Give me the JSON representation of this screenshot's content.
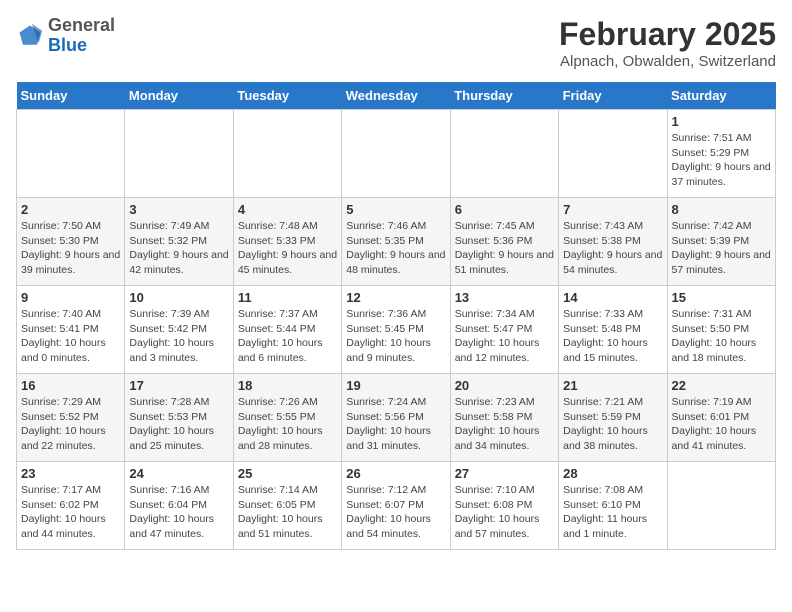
{
  "header": {
    "logo_general": "General",
    "logo_blue": "Blue",
    "month_title": "February 2025",
    "location": "Alpnach, Obwalden, Switzerland"
  },
  "days_of_week": [
    "Sunday",
    "Monday",
    "Tuesday",
    "Wednesday",
    "Thursday",
    "Friday",
    "Saturday"
  ],
  "weeks": [
    [
      {
        "day": "",
        "info": ""
      },
      {
        "day": "",
        "info": ""
      },
      {
        "day": "",
        "info": ""
      },
      {
        "day": "",
        "info": ""
      },
      {
        "day": "",
        "info": ""
      },
      {
        "day": "",
        "info": ""
      },
      {
        "day": "1",
        "info": "Sunrise: 7:51 AM\nSunset: 5:29 PM\nDaylight: 9 hours and 37 minutes."
      }
    ],
    [
      {
        "day": "2",
        "info": "Sunrise: 7:50 AM\nSunset: 5:30 PM\nDaylight: 9 hours and 39 minutes."
      },
      {
        "day": "3",
        "info": "Sunrise: 7:49 AM\nSunset: 5:32 PM\nDaylight: 9 hours and 42 minutes."
      },
      {
        "day": "4",
        "info": "Sunrise: 7:48 AM\nSunset: 5:33 PM\nDaylight: 9 hours and 45 minutes."
      },
      {
        "day": "5",
        "info": "Sunrise: 7:46 AM\nSunset: 5:35 PM\nDaylight: 9 hours and 48 minutes."
      },
      {
        "day": "6",
        "info": "Sunrise: 7:45 AM\nSunset: 5:36 PM\nDaylight: 9 hours and 51 minutes."
      },
      {
        "day": "7",
        "info": "Sunrise: 7:43 AM\nSunset: 5:38 PM\nDaylight: 9 hours and 54 minutes."
      },
      {
        "day": "8",
        "info": "Sunrise: 7:42 AM\nSunset: 5:39 PM\nDaylight: 9 hours and 57 minutes."
      }
    ],
    [
      {
        "day": "9",
        "info": "Sunrise: 7:40 AM\nSunset: 5:41 PM\nDaylight: 10 hours and 0 minutes."
      },
      {
        "day": "10",
        "info": "Sunrise: 7:39 AM\nSunset: 5:42 PM\nDaylight: 10 hours and 3 minutes."
      },
      {
        "day": "11",
        "info": "Sunrise: 7:37 AM\nSunset: 5:44 PM\nDaylight: 10 hours and 6 minutes."
      },
      {
        "day": "12",
        "info": "Sunrise: 7:36 AM\nSunset: 5:45 PM\nDaylight: 10 hours and 9 minutes."
      },
      {
        "day": "13",
        "info": "Sunrise: 7:34 AM\nSunset: 5:47 PM\nDaylight: 10 hours and 12 minutes."
      },
      {
        "day": "14",
        "info": "Sunrise: 7:33 AM\nSunset: 5:48 PM\nDaylight: 10 hours and 15 minutes."
      },
      {
        "day": "15",
        "info": "Sunrise: 7:31 AM\nSunset: 5:50 PM\nDaylight: 10 hours and 18 minutes."
      }
    ],
    [
      {
        "day": "16",
        "info": "Sunrise: 7:29 AM\nSunset: 5:52 PM\nDaylight: 10 hours and 22 minutes."
      },
      {
        "day": "17",
        "info": "Sunrise: 7:28 AM\nSunset: 5:53 PM\nDaylight: 10 hours and 25 minutes."
      },
      {
        "day": "18",
        "info": "Sunrise: 7:26 AM\nSunset: 5:55 PM\nDaylight: 10 hours and 28 minutes."
      },
      {
        "day": "19",
        "info": "Sunrise: 7:24 AM\nSunset: 5:56 PM\nDaylight: 10 hours and 31 minutes."
      },
      {
        "day": "20",
        "info": "Sunrise: 7:23 AM\nSunset: 5:58 PM\nDaylight: 10 hours and 34 minutes."
      },
      {
        "day": "21",
        "info": "Sunrise: 7:21 AM\nSunset: 5:59 PM\nDaylight: 10 hours and 38 minutes."
      },
      {
        "day": "22",
        "info": "Sunrise: 7:19 AM\nSunset: 6:01 PM\nDaylight: 10 hours and 41 minutes."
      }
    ],
    [
      {
        "day": "23",
        "info": "Sunrise: 7:17 AM\nSunset: 6:02 PM\nDaylight: 10 hours and 44 minutes."
      },
      {
        "day": "24",
        "info": "Sunrise: 7:16 AM\nSunset: 6:04 PM\nDaylight: 10 hours and 47 minutes."
      },
      {
        "day": "25",
        "info": "Sunrise: 7:14 AM\nSunset: 6:05 PM\nDaylight: 10 hours and 51 minutes."
      },
      {
        "day": "26",
        "info": "Sunrise: 7:12 AM\nSunset: 6:07 PM\nDaylight: 10 hours and 54 minutes."
      },
      {
        "day": "27",
        "info": "Sunrise: 7:10 AM\nSunset: 6:08 PM\nDaylight: 10 hours and 57 minutes."
      },
      {
        "day": "28",
        "info": "Sunrise: 7:08 AM\nSunset: 6:10 PM\nDaylight: 11 hours and 1 minute."
      },
      {
        "day": "",
        "info": ""
      }
    ]
  ]
}
